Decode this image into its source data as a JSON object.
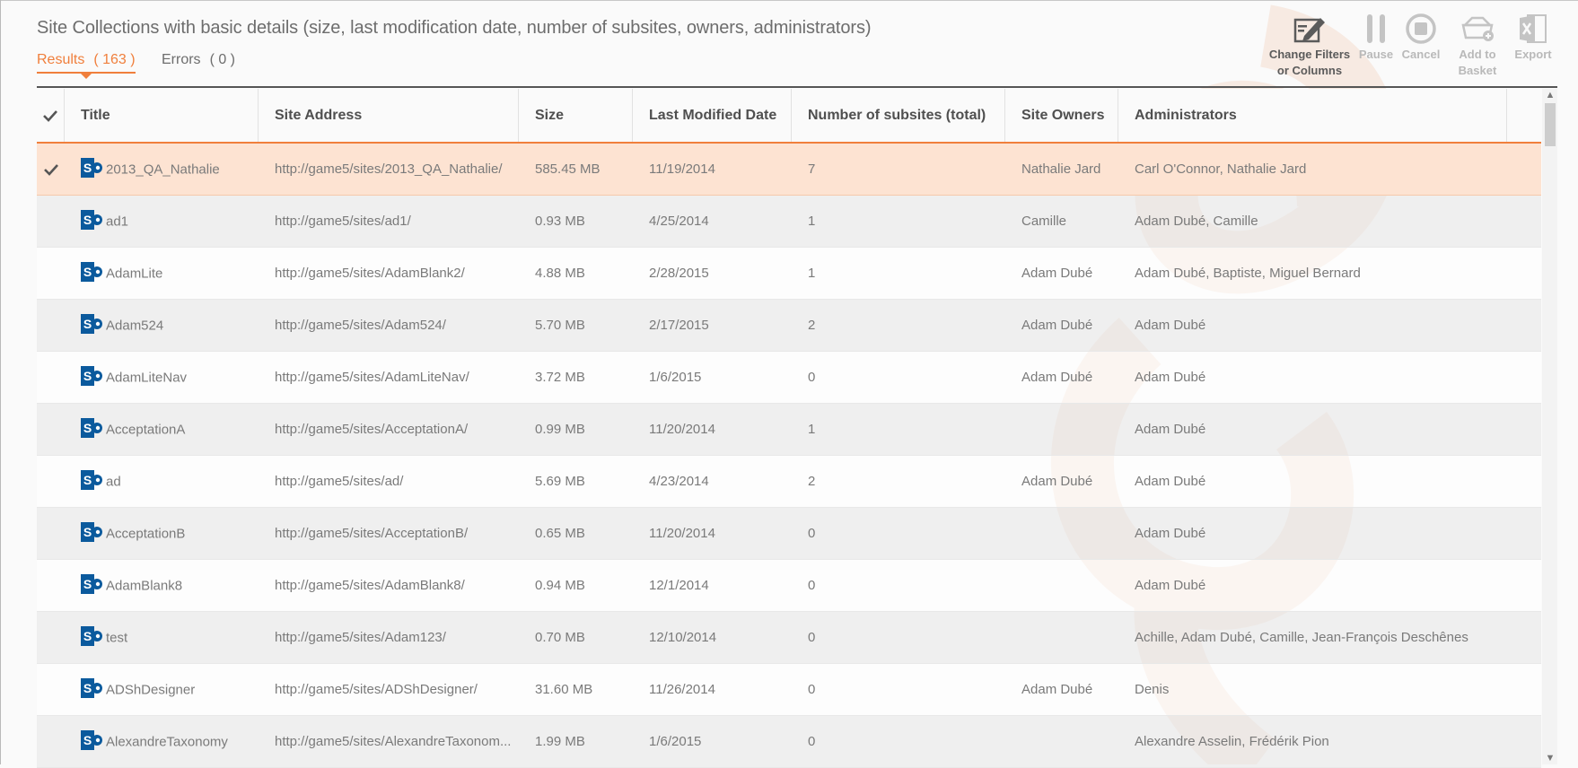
{
  "page": {
    "title": "Site Collections with basic details (size, last modification date, number of subsites, owners, administrators)"
  },
  "tabs": {
    "results": {
      "label": "Results",
      "count": "( 163 )"
    },
    "errors": {
      "label": "Errors",
      "count": "( 0 )"
    }
  },
  "toolbar": {
    "change_filters": {
      "line1": "Change Filters",
      "line2": "or Columns",
      "icon": "edit-filter-icon"
    },
    "pause": {
      "label": "Pause",
      "icon": "pause-icon"
    },
    "cancel": {
      "label": "Cancel",
      "icon": "stop-icon"
    },
    "add_to_basket": {
      "line1": "Add to",
      "line2": "Basket",
      "icon": "basket-icon"
    },
    "export": {
      "label": "Export",
      "icon": "excel-icon"
    }
  },
  "table": {
    "columns": {
      "title": "Title",
      "address": "Site Address",
      "size": "Size",
      "modified": "Last Modified Date",
      "subsites": "Number of subsites (total)",
      "owners": "Site Owners",
      "admins": "Administrators"
    },
    "rows": [
      {
        "title": "2013_QA_Nathalie",
        "address": "http://game5/sites/2013_QA_Nathalie/",
        "size": "585.45 MB",
        "modified": "11/19/2014",
        "subsites": "7",
        "owners": "Nathalie Jard",
        "admins": "Carl O'Connor, Nathalie Jard",
        "selected": true
      },
      {
        "title": "ad1",
        "address": "http://game5/sites/ad1/",
        "size": "0.93 MB",
        "modified": "4/25/2014",
        "subsites": "1",
        "owners": "Camille",
        "admins": "Adam Dubé, Camille",
        "selected": false
      },
      {
        "title": "AdamLite",
        "address": "http://game5/sites/AdamBlank2/",
        "size": "4.88 MB",
        "modified": "2/28/2015",
        "subsites": "1",
        "owners": "Adam Dubé",
        "admins": "Adam Dubé, Baptiste, Miguel Bernard",
        "selected": false
      },
      {
        "title": "Adam524",
        "address": "http://game5/sites/Adam524/",
        "size": "5.70 MB",
        "modified": "2/17/2015",
        "subsites": "2",
        "owners": "Adam Dubé",
        "admins": "Adam Dubé",
        "selected": false
      },
      {
        "title": "AdamLiteNav",
        "address": "http://game5/sites/AdamLiteNav/",
        "size": "3.72 MB",
        "modified": "1/6/2015",
        "subsites": "0",
        "owners": "Adam Dubé",
        "admins": "Adam Dubé",
        "selected": false
      },
      {
        "title": "AcceptationA",
        "address": "http://game5/sites/AcceptationA/",
        "size": "0.99 MB",
        "modified": "11/20/2014",
        "subsites": "1",
        "owners": "",
        "admins": "Adam Dubé",
        "selected": false
      },
      {
        "title": "ad",
        "address": "http://game5/sites/ad/",
        "size": "5.69 MB",
        "modified": "4/23/2014",
        "subsites": "2",
        "owners": "Adam Dubé",
        "admins": "Adam Dubé",
        "selected": false
      },
      {
        "title": "AcceptationB",
        "address": "http://game5/sites/AcceptationB/",
        "size": "0.65 MB",
        "modified": "11/20/2014",
        "subsites": "0",
        "owners": "",
        "admins": "Adam Dubé",
        "selected": false
      },
      {
        "title": "AdamBlank8",
        "address": "http://game5/sites/AdamBlank8/",
        "size": "0.94 MB",
        "modified": "12/1/2014",
        "subsites": "0",
        "owners": "",
        "admins": "Adam Dubé",
        "selected": false
      },
      {
        "title": "test",
        "address": "http://game5/sites/Adam123/",
        "size": "0.70 MB",
        "modified": "12/10/2014",
        "subsites": "0",
        "owners": "",
        "admins": "Achille, Adam Dubé, Camille, Jean-François Deschênes",
        "selected": false
      },
      {
        "title": "ADShDesigner",
        "address": "http://game5/sites/ADShDesigner/",
        "size": "31.60 MB",
        "modified": "11/26/2014",
        "subsites": "0",
        "owners": "Adam Dubé",
        "admins": "Denis",
        "selected": false
      },
      {
        "title": "AlexandreTaxonomy",
        "address": "http://game5/sites/AlexandreTaxonom...",
        "size": "1.99 MB",
        "modified": "1/6/2015",
        "subsites": "0",
        "owners": "",
        "admins": "Alexandre Asselin, Frédérik Pion",
        "selected": false
      }
    ]
  },
  "colors": {
    "accent": "#f07f3c",
    "selected_row": "#fde3d2",
    "sharepoint_blue": "#0b5a9d"
  }
}
